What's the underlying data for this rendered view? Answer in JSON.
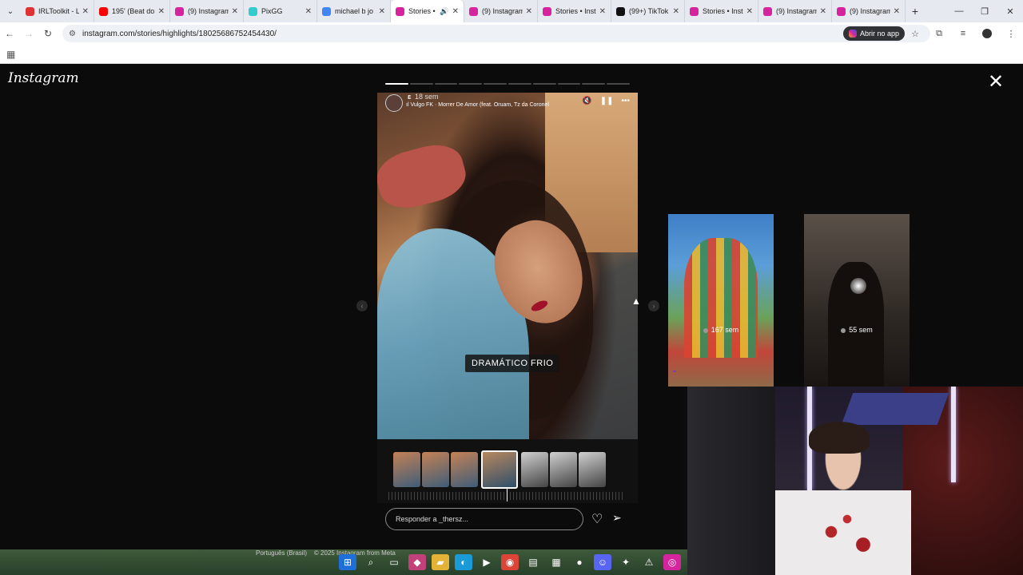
{
  "browser": {
    "tabs": [
      {
        "label": "IRLToolkit - L",
        "fav_color": "#d33"
      },
      {
        "label": "195' (Beat do",
        "fav_color": "#f00"
      },
      {
        "label": "(9) Instagram",
        "fav_color": "#d6249f"
      },
      {
        "label": "PixGG",
        "fav_color": "#3cc"
      },
      {
        "label": "michael b jo",
        "fav_color": "#4285f4"
      },
      {
        "label": "Stories •",
        "fav_color": "#d6249f",
        "active": true
      },
      {
        "label": "(9) Instagram",
        "fav_color": "#d6249f"
      },
      {
        "label": "Stories • Insta",
        "fav_color": "#d6249f"
      },
      {
        "label": "(99+) TikTok",
        "fav_color": "#111"
      },
      {
        "label": "Stories • Insta",
        "fav_color": "#d6249f"
      },
      {
        "label": "(9) Instagram",
        "fav_color": "#d6249f"
      },
      {
        "label": "(9) Instagram",
        "fav_color": "#d6249f"
      }
    ],
    "url": "instagram.com/stories/highlights/18025686752454430/",
    "open_app_label": "Abrir no app"
  },
  "instagram": {
    "logo": "Instagram",
    "story": {
      "username": "ɛ",
      "time_ago": "18 sem",
      "music": "Vulgo FK · Morrer De Amor (feat. Oruam, Tz da Coronel",
      "filter_name": "DRAMÁTICO FRIO",
      "progress_total": 10,
      "progress_done": 1
    },
    "reply_placeholder": "Responder a _thersz...",
    "previews": [
      {
        "age": "167 sem"
      },
      {
        "age": "55 sem"
      }
    ],
    "footer": {
      "language": "Português (Brasil)",
      "copyright": "© 2025 Instagram from Meta"
    }
  },
  "icons": {
    "close": "✕",
    "heart": "♡",
    "send": "➢",
    "mute": "🔇",
    "pause": "❚❚",
    "more": "•••",
    "prev": "‹",
    "next": "›"
  }
}
